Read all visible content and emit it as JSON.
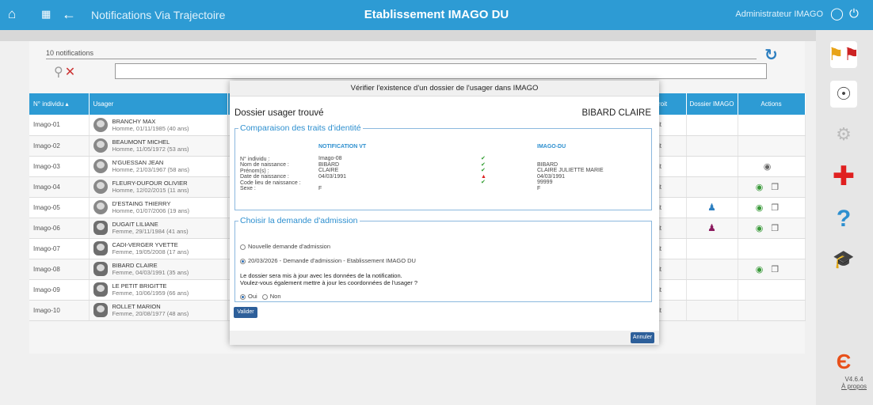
{
  "topbar": {
    "home_icon": "home-icon",
    "apps_icon": "apps-grid-icon",
    "back_icon": "back-arrow-icon",
    "app_title": "Notifications Via Trajectoire",
    "center_title": "Etablissement IMAGO DU",
    "user": "Administrateur IMAGO",
    "user_icon": "user-icon",
    "power_icon": "power-icon",
    "color": "#2d9bd4"
  },
  "toolbar": {
    "notif_count": "10 notifications",
    "search_placeholder": "",
    "search_icon": "search-icon",
    "clear_icon": "clear-filter-icon",
    "refresh_icon": "refresh-icon"
  },
  "table": {
    "headers": [
      "N° individu ▴",
      "Usager",
      "",
      "",
      "",
      "",
      "",
      "droit",
      "Dossier IMAGO",
      "Actions"
    ],
    "rows": [
      {
        "id": "Imago-01",
        "name": "BRANCHY MAX",
        "sub": "Homme, 01/11/1985 (40 ans)",
        "sex": "m",
        "droit": "oit",
        "dossier": "",
        "actions": []
      },
      {
        "id": "Imago-02",
        "name": "BEAUMONT MICHEL",
        "sub": "Homme, 11/05/1972 (53 ans)",
        "sex": "m",
        "droit": "oit",
        "dossier": "",
        "actions": []
      },
      {
        "id": "Imago-03",
        "name": "N'GUESSAN JEAN",
        "sub": "Homme, 21/03/1967 (58 ans)",
        "sex": "m",
        "droit": "oit",
        "dossier": "",
        "actions": [
          "view-gray"
        ]
      },
      {
        "id": "Imago-04",
        "name": "FLEURY-DUFOUR OLIVIER",
        "sub": "Homme, 12/02/2015 (11 ans)",
        "sex": "m",
        "droit": "oit",
        "dossier": "",
        "actions": [
          "view",
          "copy"
        ]
      },
      {
        "id": "Imago-05",
        "name": "D'ESTAING THIERRY",
        "sub": "Homme, 01/07/2006 (19 ans)",
        "sex": "m",
        "droit": "oit",
        "dossier": "blue",
        "actions": [
          "view",
          "copy"
        ]
      },
      {
        "id": "Imago-06",
        "name": "DUGAIT LILIANE",
        "sub": "Femme, 29/11/1984 (41 ans)",
        "sex": "f",
        "droit": "oit",
        "dossier": "purple",
        "actions": [
          "view",
          "copy"
        ]
      },
      {
        "id": "Imago-07",
        "name": "CADI-VERGER YVETTE",
        "sub": "Femme, 19/05/2008 (17 ans)",
        "sex": "f",
        "droit": "oit",
        "dossier": "",
        "actions": []
      },
      {
        "id": "Imago-08",
        "name": "BIBARD CLAIRE",
        "sub": "Femme, 04/03/1991 (35 ans)",
        "sex": "f",
        "droit": "oit",
        "dossier": "",
        "actions": [
          "view",
          "copy"
        ]
      },
      {
        "id": "Imago-09",
        "name": "LE PETIT BRIGITTE",
        "sub": "Femme, 10/06/1959 (66 ans)",
        "sex": "f",
        "droit": "oit",
        "dossier": "",
        "actions": []
      },
      {
        "id": "Imago-10",
        "name": "ROLLET MARION",
        "sub": "Femme, 20/08/1977 (48 ans)",
        "sex": "f",
        "droit": "oit",
        "dossier": "",
        "actions": []
      }
    ]
  },
  "sidebar": {
    "items": [
      {
        "icon": "flags-icon",
        "color": "#e8a317"
      },
      {
        "icon": "support-headset-icon",
        "color": "#444444"
      },
      {
        "icon": "settings-gear-icon",
        "color": "#bbbbbb"
      },
      {
        "icon": "medical-cross-icon",
        "color": "#e02020"
      },
      {
        "icon": "help-question-icon",
        "color": "#2d8fcf"
      },
      {
        "icon": "training-cap-icon",
        "color": "#2d5f9a"
      }
    ],
    "logo_icon": "imago-logo-icon",
    "version": "V4.6.4",
    "about": "À propos"
  },
  "modal": {
    "title": "Vérifier l'existence d'un dossier de l'usager dans IMAGO",
    "found": "Dossier usager trouvé",
    "patient": "BIBARD CLAIRE",
    "ident_legend": "Comparaison des traits d'identité",
    "col_vt": "NOTIFICATION VT",
    "col_du": "IMAGO-DU",
    "fields": [
      {
        "label": "N° individu :",
        "vt": "Imago-08",
        "status": "",
        "du": ""
      },
      {
        "label": "Nom de naissance :",
        "vt": "BIBARD",
        "status": "ok",
        "du": "BIBARD"
      },
      {
        "label": "Prénom(s) :",
        "vt": "CLAIRE",
        "status": "ok",
        "du": "CLAIRE JULIETTE MARIE"
      },
      {
        "label": "Date de naissance :",
        "vt": "04/03/1991",
        "status": "ok",
        "du": "04/03/1991"
      },
      {
        "label": "Code lieu de naissance :",
        "vt": "",
        "status": "warn",
        "du": "99999"
      },
      {
        "label": "Sexe :",
        "vt": "F",
        "status": "ok",
        "du": "F"
      }
    ],
    "adm_legend": "Choisir la demande d'admission",
    "opt_new": "Nouvelle demande d'admission",
    "opt_existing": "20/03/2026 - Demande d'admission - Etablissement IMAGO DU",
    "msg1": "Le dossier sera mis à jour avec les données de la notification.",
    "msg2": "Voulez-vous également mettre à jour les coordonnées de l'usager ?",
    "oui": "Oui",
    "non": "Non",
    "validate": "Valider",
    "cancel": "Annuler"
  }
}
